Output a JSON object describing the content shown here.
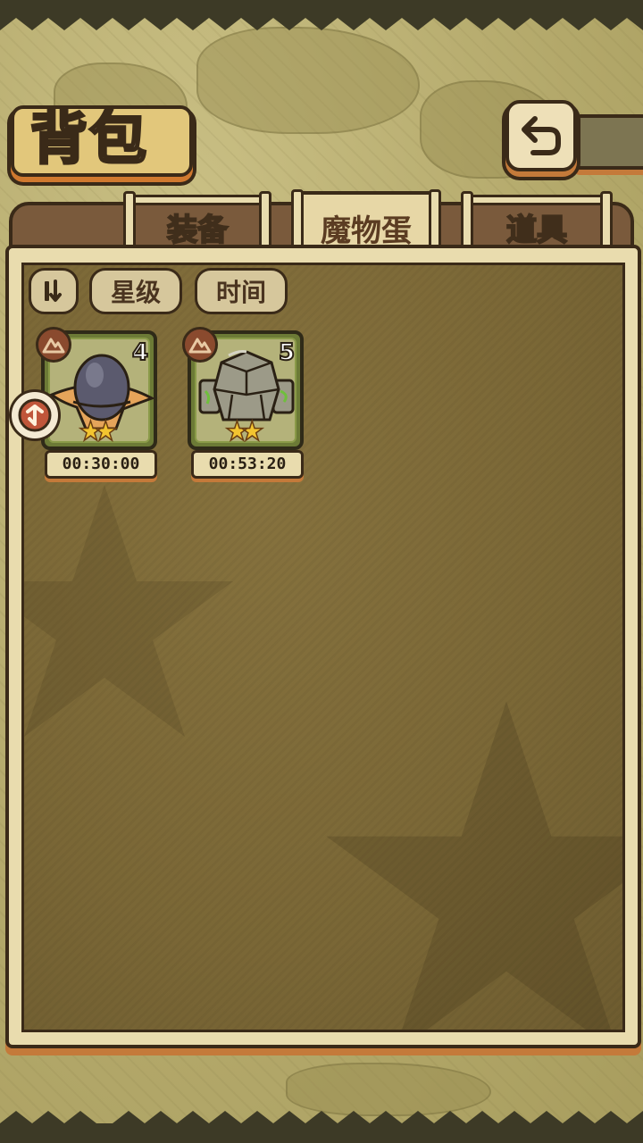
{
  "header": {
    "title": "背包"
  },
  "tabs": [
    {
      "label": "装备",
      "active": false
    },
    {
      "label": "魔物蛋",
      "active": true
    },
    {
      "label": "道具",
      "active": false
    }
  ],
  "filters": {
    "sort_icon": "sort-toggle-icon",
    "star_label": "星级",
    "time_label": "时间"
  },
  "eggs": [
    {
      "count": "4",
      "stars": "★★",
      "timer": "00:30:00",
      "icon": "wizard-hat-egg-icon",
      "rank_icon": "mountain-rank-icon"
    },
    {
      "count": "5",
      "stars": "★★",
      "timer": "00:53:20",
      "icon": "stone-golem-egg-icon",
      "rank_icon": "mountain-rank-icon"
    }
  ],
  "colors": {
    "panel_bg": "#7a6736",
    "frame": "#e9dcae",
    "outline": "#3a2a18",
    "accent_orange": "#c47a3a",
    "star_yellow": "#f3c530"
  }
}
